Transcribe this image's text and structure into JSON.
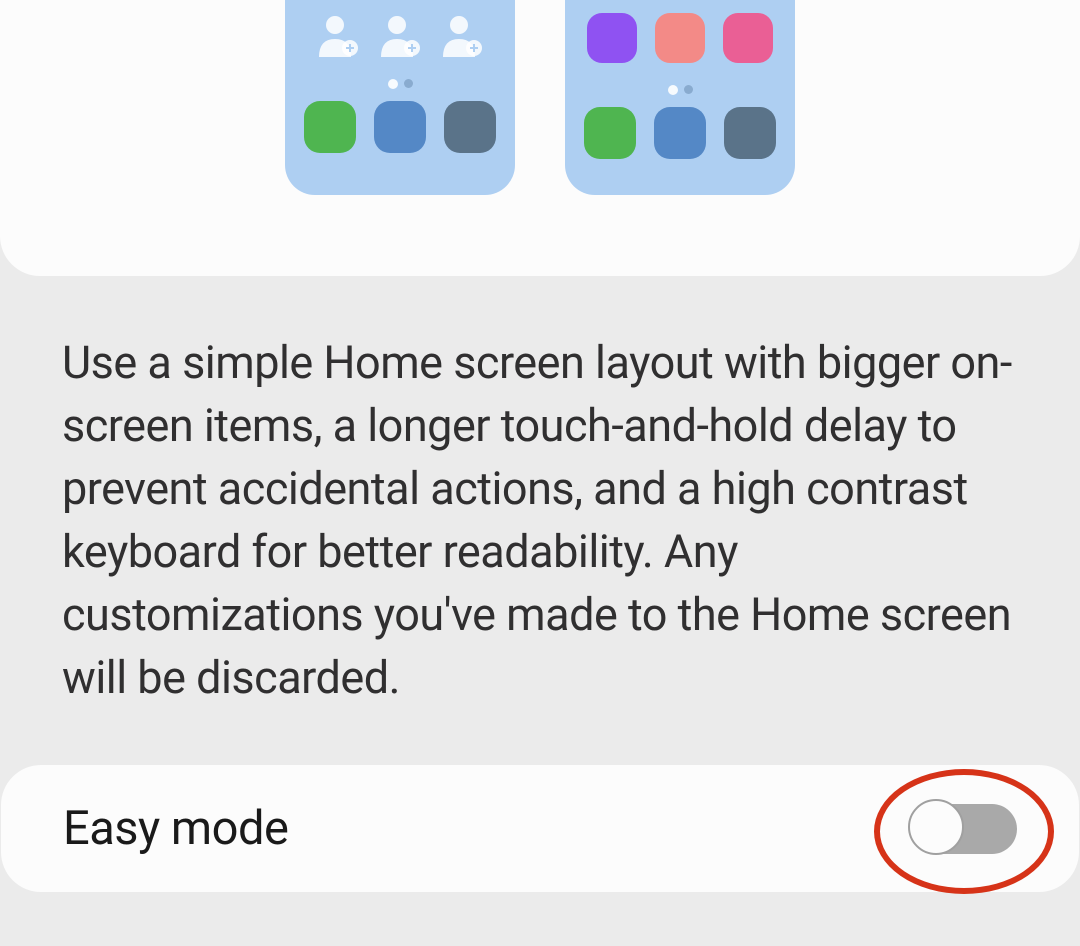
{
  "description": "Use a simple Home screen layout with bigger on-screen items, a longer touch-and-hold delay to prevent accidental actions, and a high contrast keyboard for better readability. Any customizations you've made to the Home screen will be discarded.",
  "easy_mode": {
    "label": "Easy mode",
    "enabled": false
  },
  "previews": {
    "left": {
      "contacts_count": 3,
      "dock_colors": [
        "#4fb550",
        "#5488c6",
        "#5a7389"
      ]
    },
    "right": {
      "app_colors": [
        "#8f52f2",
        "#f38a87",
        "#ea5f95"
      ],
      "dock_colors": [
        "#4fb550",
        "#5488c6",
        "#5a7389"
      ]
    }
  },
  "icon_names": {
    "contact": "add-contact-icon"
  }
}
